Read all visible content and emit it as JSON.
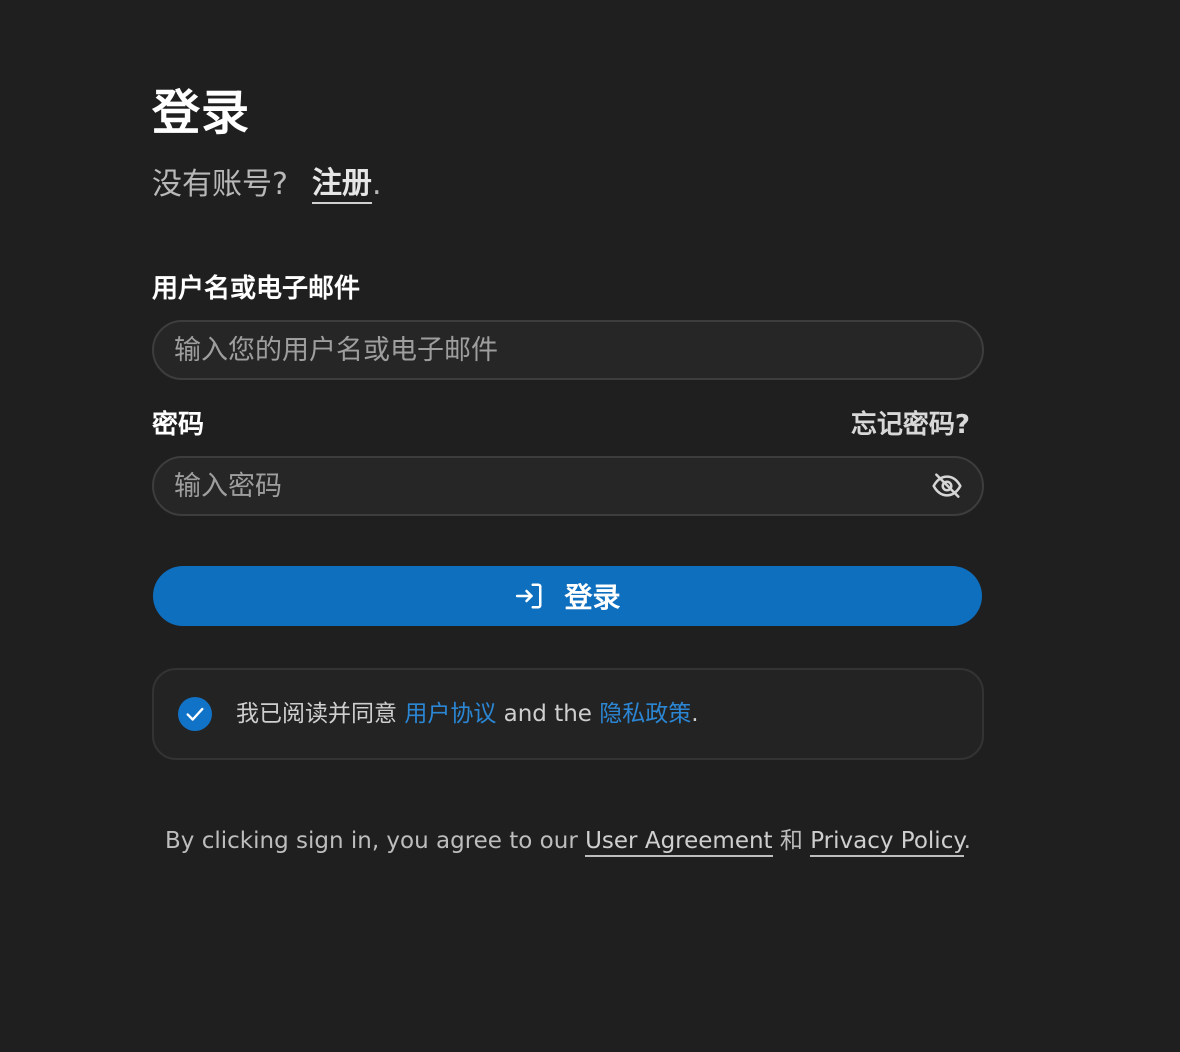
{
  "header": {
    "title": "登录",
    "signup_prompt": "没有账号?",
    "signup_link": "注册",
    "signup_period": "."
  },
  "form": {
    "username": {
      "label": "用户名或电子邮件",
      "placeholder": "输入您的用户名或电子邮件",
      "value": ""
    },
    "password": {
      "label": "密码",
      "forgot_link": "忘记密码?",
      "placeholder": "输入密码",
      "value": "",
      "visibility_icon": "eye-off-icon"
    },
    "submit": {
      "label": "登录",
      "icon": "login-icon"
    }
  },
  "agreement": {
    "checked": true,
    "text_before": "我已阅读并同意",
    "link_1": "用户协议",
    "text_middle": "and the",
    "link_2": "隐私政策",
    "text_after": "."
  },
  "footer": {
    "text_before": "By clicking sign in, you agree to our",
    "link_1": "User Agreement",
    "text_middle": "和",
    "link_2": "Privacy Policy",
    "text_after": "."
  },
  "colors": {
    "background": "#1f1f1f",
    "accent": "#0e6fbf",
    "link_blue": "#2b86d4",
    "input_bg": "#262626",
    "input_border": "#3d3d3d"
  }
}
